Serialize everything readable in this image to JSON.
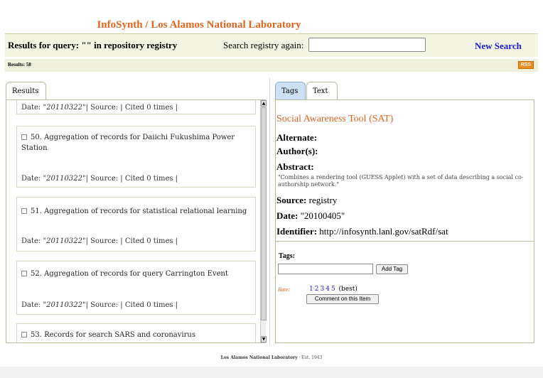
{
  "header": {
    "title": "InfoSynth / Los Alamos National Laboratory"
  },
  "query_bar": {
    "query_text": "Results for query: \"\" in repository registry",
    "search_label": "Search registry again:",
    "search_value": "",
    "new_search": "New Search"
  },
  "results_count": "Results: 58",
  "rss_label": "RSS",
  "left_tabs": [
    {
      "label": "Results"
    }
  ],
  "results": [
    {
      "title": "",
      "date": "\"20110322\"",
      "meta": "| Source: | Cited 0 times |"
    },
    {
      "title": "50. Aggregation of records for Daiichi Fukushima Power Station",
      "date": "\"20110322\"",
      "meta": "| Source: | Cited 0 times |"
    },
    {
      "title": "51. Aggregation of records for statistical relational learning",
      "date": "\"20110322\"",
      "meta": "| Source: | Cited 0 times |"
    },
    {
      "title": "52. Aggregation of records for query Carrington Event",
      "date": "\"20110322\"",
      "meta": "| Source: | Cited 0 times |"
    },
    {
      "title": "53. Records for search SARS and coronavirus",
      "date": "",
      "meta": ""
    }
  ],
  "date_label": "Date:",
  "right_tabs": [
    {
      "label": "Tags"
    },
    {
      "label": "Text"
    }
  ],
  "detail": {
    "title": "Social Awareness Tool (SAT)",
    "alternate_label": "Alternate:",
    "authors_label": "Author(s):",
    "abstract_label": "Abstract:",
    "abstract": "\"Combines a rendering tool (GUESS Applet) with a set of data describing a social co-authorship network.\"",
    "source_label": "Source:",
    "source": "registry",
    "date_label": "Date:",
    "date": "\"20100405\"",
    "identifier_label": "Identifier:",
    "identifier": "http://infosynth.lanl.gov/satRdf/sat"
  },
  "tags": {
    "label": "Tags:",
    "input_value": "",
    "add_button": "Add Tag",
    "rate_label": "Rate:",
    "rate_values": [
      "1",
      "2",
      "3",
      "4",
      "5"
    ],
    "rate_suffix": "(best)",
    "comment_button": "Comment on this Item"
  },
  "footer": {
    "org": "Los Alamos National Laboratory",
    "est": "Est. 1943"
  },
  "colors": {
    "accent": "#e0641c",
    "link": "#1a1ad6",
    "bar": "#f4f6e3",
    "rss": "#ef8a1b"
  }
}
